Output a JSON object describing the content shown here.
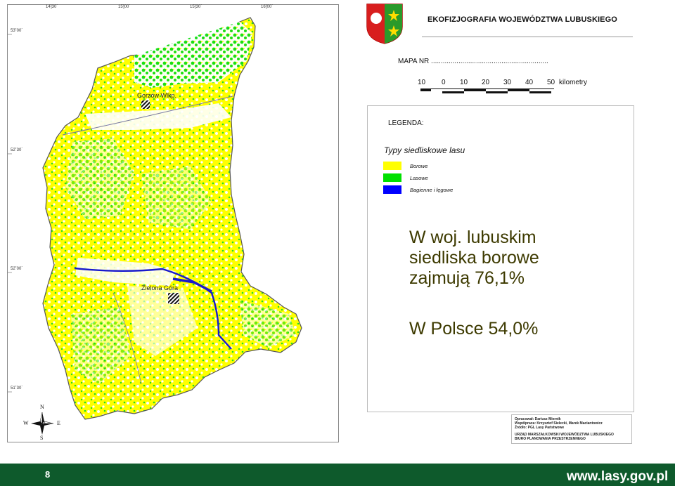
{
  "map": {
    "lon_labels": [
      "14˚30´",
      "15˚00´",
      "15˚30´",
      "16˚00´"
    ],
    "lat_labels": [
      "53˚00´",
      "52˚30´",
      "52˚00´",
      "51˚30´"
    ],
    "cities": [
      "Gorzów Wlkp.",
      "Zielona Góra"
    ],
    "compass": {
      "n": "N",
      "s": "S",
      "e": "E",
      "w": "W"
    },
    "colors": {
      "borowe": "#ffff00",
      "lasowe": "#00e000",
      "bagienne": "#0000ff",
      "border": "#555555"
    }
  },
  "header": {
    "title": "EKOFIZJOGRAFIA WOJEWÓDZTWA LUBUSKIEGO",
    "mapa_nr": "MAPA NR ............................................................"
  },
  "scale": {
    "labels": [
      "10",
      "0",
      "10",
      "20",
      "30",
      "40",
      "50"
    ],
    "unit": "kilometry"
  },
  "legend": {
    "title": "LEGENDA:",
    "subtitle": "Typy siedliskowe lasu",
    "items": [
      {
        "label": "Borowe",
        "color": "#ffff00"
      },
      {
        "label": "Lasowe",
        "color": "#00e000"
      },
      {
        "label": "Bagienne i łęgowe",
        "color": "#0000ff"
      }
    ]
  },
  "statement": {
    "line1": "W woj. lubuskim",
    "line2": "siedliska borowe",
    "line3": "zajmują 76,1%",
    "poland": "W Polsce 54,0%"
  },
  "credits": {
    "line1": "Opracował: Dariusz Miernik",
    "line2": "Współpraca: Krzysztof Sielecki, Marek Maciantowicz",
    "line3": "Źródło: PGL Lasy Państwowe",
    "line4": "URZĄD MARSZAŁKOWSKI WOJEWÓDZTWA LUBUSKIEGO",
    "line5": "BIURO PLANOWANIA PRZESTRZENNEGO"
  },
  "footer": {
    "page": "8",
    "url": "www.lasy.gov.pl"
  }
}
